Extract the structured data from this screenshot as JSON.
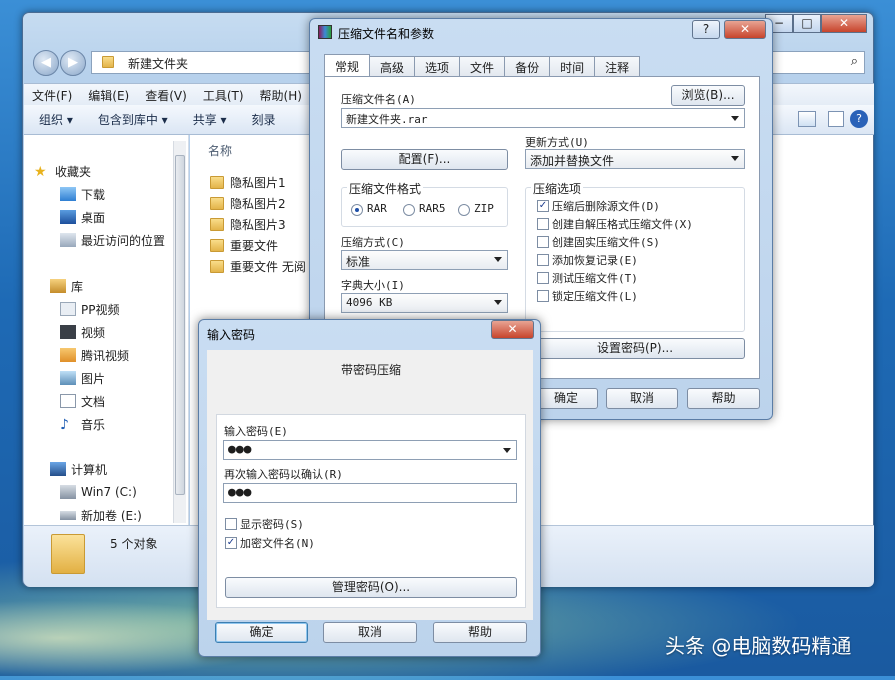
{
  "explorer": {
    "breadcrumb": "新建文件夹",
    "menu": [
      "文件(F)",
      "编辑(E)",
      "查看(V)",
      "工具(T)",
      "帮助(H)"
    ],
    "toolbar": [
      "组织 ▾",
      "包含到库中 ▾",
      "共享 ▾",
      "刻录"
    ],
    "nav": {
      "favorites": "收藏夹",
      "fav_items": [
        "下载",
        "桌面",
        "最近访问的位置"
      ],
      "libraries": "库",
      "lib_items": [
        "PP视频",
        "视频",
        "腾讯视频",
        "图片",
        "文档",
        "音乐"
      ],
      "computer": "计算机",
      "drives": [
        "Win7 (C:)",
        "新加卷 (E:)"
      ]
    },
    "column_header": "名称",
    "files": [
      "隐私图片1",
      "隐私图片2",
      "隐私图片3",
      "重要文件",
      "重要文件 无阅"
    ],
    "status": "5 个对象",
    "win_buttons": {
      "min": "−",
      "max": "□",
      "close": "✕"
    }
  },
  "archive_dialog": {
    "title": "压缩文件名和参数",
    "help": "?",
    "close": "✕",
    "tabs": [
      "常规",
      "高级",
      "选项",
      "文件",
      "备份",
      "时间",
      "注释"
    ],
    "archive_name_label": "压缩文件名(A)",
    "browse": "浏览(B)...",
    "archive_name": "新建文件夹.rar",
    "update_mode_label": "更新方式(U)",
    "update_mode": "添加并替换文件",
    "profile_button": "配置(F)...",
    "format_label": "压缩文件格式",
    "formats": [
      "RAR",
      "RAR5",
      "ZIP"
    ],
    "selected_format": "RAR",
    "options_label": "压缩选项",
    "options": [
      {
        "label": "压缩后删除源文件(D)",
        "checked": true
      },
      {
        "label": "创建自解压格式压缩文件(X)",
        "checked": false
      },
      {
        "label": "创建固实压缩文件(S)",
        "checked": false
      },
      {
        "label": "添加恢复记录(E)",
        "checked": false
      },
      {
        "label": "测试压缩文件(T)",
        "checked": false
      },
      {
        "label": "锁定压缩文件(L)",
        "checked": false
      }
    ],
    "method_label": "压缩方式(C)",
    "method": "标准",
    "dict_label": "字典大小(I)",
    "dict": "4096 KB",
    "set_password": "设置密码(P)...",
    "ok": "确定",
    "cancel": "取消",
    "help_button": "帮助"
  },
  "password_dialog": {
    "title": "输入密码",
    "close": "✕",
    "heading": "带密码压缩",
    "enter_label": "输入密码(E)",
    "enter_value": "●●●",
    "confirm_label": "再次输入密码以确认(R)",
    "confirm_value": "●●●",
    "show_password": "显示密码(S)",
    "show_password_checked": false,
    "encrypt_names": "加密文件名(N)",
    "encrypt_names_checked": true,
    "manage": "管理密码(O)...",
    "ok": "确定",
    "cancel": "取消",
    "help_button": "帮助"
  },
  "watermark": "头条 @电脑数码精通"
}
